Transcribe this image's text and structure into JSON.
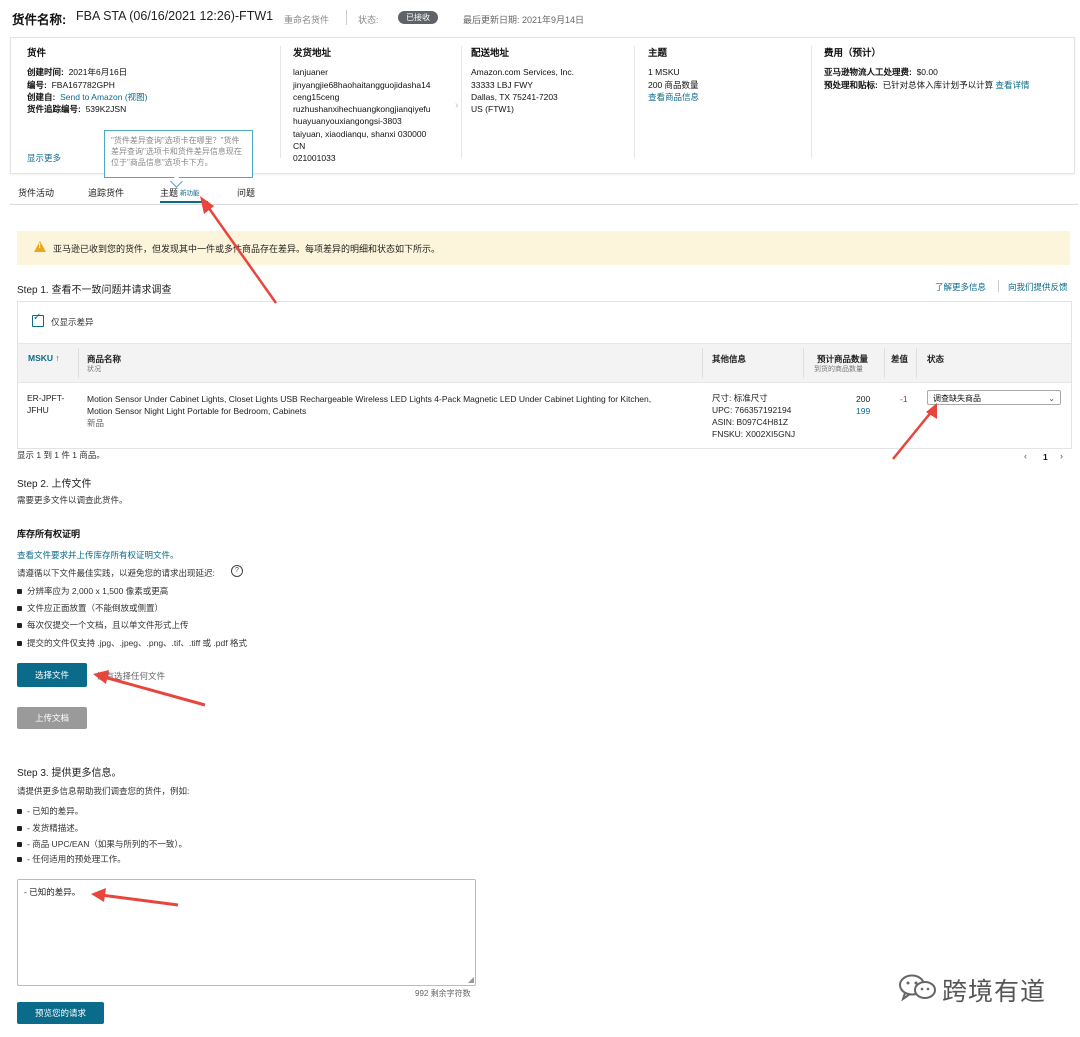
{
  "header": {
    "title_label": "货件名称:",
    "shipment_name": "FBA STA (06/16/2021 12:26)-FTW1",
    "rename_link": "重命名货件",
    "status_label": "状态:",
    "status_value": "已接收",
    "last_updated": "最后更新日期: 2021年9月14日"
  },
  "info": {
    "shipment": {
      "heading": "货件",
      "created_label": "创建时间:",
      "created_value": "2021年6月16日",
      "id_label": "编号:",
      "id_value": "FBA167782GPH",
      "created_from_label": "创建自:",
      "created_from_value": "Send to Amazon",
      "created_from_view": "(视图)",
      "tracking_label": "货件追踪编号:",
      "tracking_value": "539K2JSN",
      "show_more": "显示更多"
    },
    "ship_from": {
      "heading": "发货地址",
      "lines": [
        "lanjuaner",
        "jinyangjie68haohaitangguojidasha14",
        "ceng15ceng",
        "ruzhushanxihechuangkongjianqiyefu",
        "huayuanyouxiangongsi-3803",
        "taiyuan, xiaodianqu, shanxi 030000",
        "CN",
        "021001033"
      ]
    },
    "ship_to": {
      "heading": "配送地址",
      "lines": [
        "Amazon.com Services, Inc.",
        "33333 LBJ FWY",
        "Dallas, TX 75241-7203",
        "US (FTW1)"
      ]
    },
    "contents": {
      "heading": "主题",
      "msku": "1 MSKU",
      "units": "200 商品数量",
      "view_link": "查看商品信息"
    },
    "fees": {
      "heading": "费用（预计）",
      "manual_label": "亚马逊物流人工处理费:",
      "manual_value": "$0.00",
      "prep_label": "预处理和贴标:",
      "prep_value": "已针对总体入库计划予以计算",
      "prep_link": "查看详情"
    }
  },
  "tooltip": "\"货件差异查询\"选项卡在哪里？\"货件差异查询\"选项卡和货件差异信息现在位于\"商品信息\"选项卡下方。",
  "tabs": [
    {
      "label": "货件活动"
    },
    {
      "label": "追踪货件"
    },
    {
      "label": "主题",
      "badge": "新功能"
    },
    {
      "label": "问题"
    }
  ],
  "alert": {
    "text": "亚马逊已收到您的货件，但发现其中一件或多件商品存在差异。每项差异的明细和状态如下所示。"
  },
  "step1": {
    "title": "Step 1. 查看不一致问题并请求调查",
    "learn_more": "了解更多信息",
    "feedback": "向我们提供反馈",
    "filter_label": "仅显示差异",
    "columns": {
      "msku": "MSKU ↑",
      "name": "商品名称",
      "name_sub": "状况",
      "other": "其他信息",
      "expected": "预计商品数量",
      "expected_sub": "到货的商品数量",
      "diff": "差值",
      "status": "状态"
    },
    "row": {
      "msku_line1": "ER-JPFT-",
      "msku_line2": "JFHU",
      "name_line1": "Motion Sensor Under Cabinet Lights, Closet Lights USB Rechargeable Wireless LED Lights 4-Pack Magnetic LED Under Cabinet Lighting for Kitchen,",
      "name_line2": "Motion Sensor Night Light Portable for Bedroom, Cabinets",
      "condition": "新品",
      "size": "尺寸: 标准尺寸",
      "upc": "UPC: 766357192194",
      "asin": "ASIN: B097C4H81Z",
      "fnsku": "FNSKU: X002XI5GNJ",
      "expected": "200",
      "received": "199",
      "diff": "-1",
      "status_select": "调查缺失商品"
    },
    "pager_text": "显示 1 到 1 件 1 商品。",
    "page": "1"
  },
  "step2": {
    "title": "Step 2. 上传文件",
    "subtitle": "需要更多文件以调查此货件。",
    "proof_title": "库存所有权证明",
    "proof_link": "查看文件要求并上传库存所有权证明文件。",
    "proof_hint": "请遵循以下文件最佳实践，以避免您的请求出现延迟:",
    "bullets": [
      "分辨率应为 2,000 x 1,500 像素或更高",
      "文件应正面放置（不能倒放或侧置）",
      "每次仅提交一个文档，且以单文件形式上传",
      "提交的文件仅支持 .jpg、.jpeg、.png、.tif、.tiff 或 .pdf 格式"
    ],
    "choose_button": "选择文件",
    "no_file": "没有选择任何文件",
    "upload_button": "上传文档"
  },
  "step3": {
    "title": "Step 3. 提供更多信息。",
    "subtitle": "请提供更多信息帮助我们调查您的货件，例如:",
    "bullets": [
      "- 已知的差异。",
      "- 发货精描述。",
      "- 商品 UPC/EAN（如果与所列的不一致）。",
      "- 任何适用的预处理工作。"
    ],
    "textarea_value": "- 已知的差异。",
    "char_count": "992 剩余字符数",
    "preview_button": "预览您的请求"
  },
  "watermark": {
    "text": "跨境有道"
  },
  "colors": {
    "accent": "#0a6b8a",
    "alert_bg": "#fdf5db",
    "arrow": "#e8453c",
    "badge": "#5f6368"
  }
}
